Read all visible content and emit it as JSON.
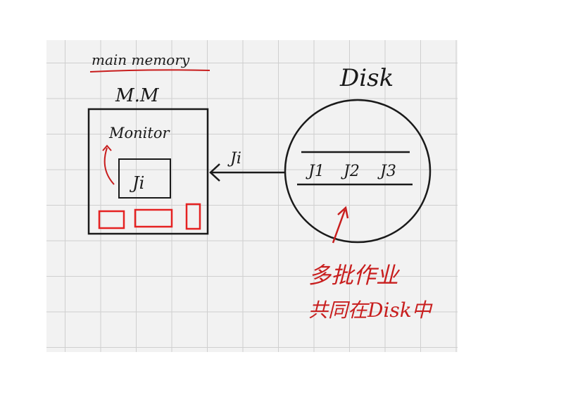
{
  "labels": {
    "main_memory": "main memory",
    "mm": "M.M",
    "monitor": "Monitor",
    "job_in_memory": "Ji",
    "transfer_job": "Ji",
    "disk": "Disk",
    "jobs": [
      "J1",
      "J2",
      "J3"
    ],
    "note_line1": "多批作业",
    "note_line2": "共同在Disk中"
  },
  "colors": {
    "ink": "#1a1a1a",
    "annotation": "#c81e1e",
    "grid_background": "#f2f2f2",
    "grid_line": "#cfcfcf"
  }
}
